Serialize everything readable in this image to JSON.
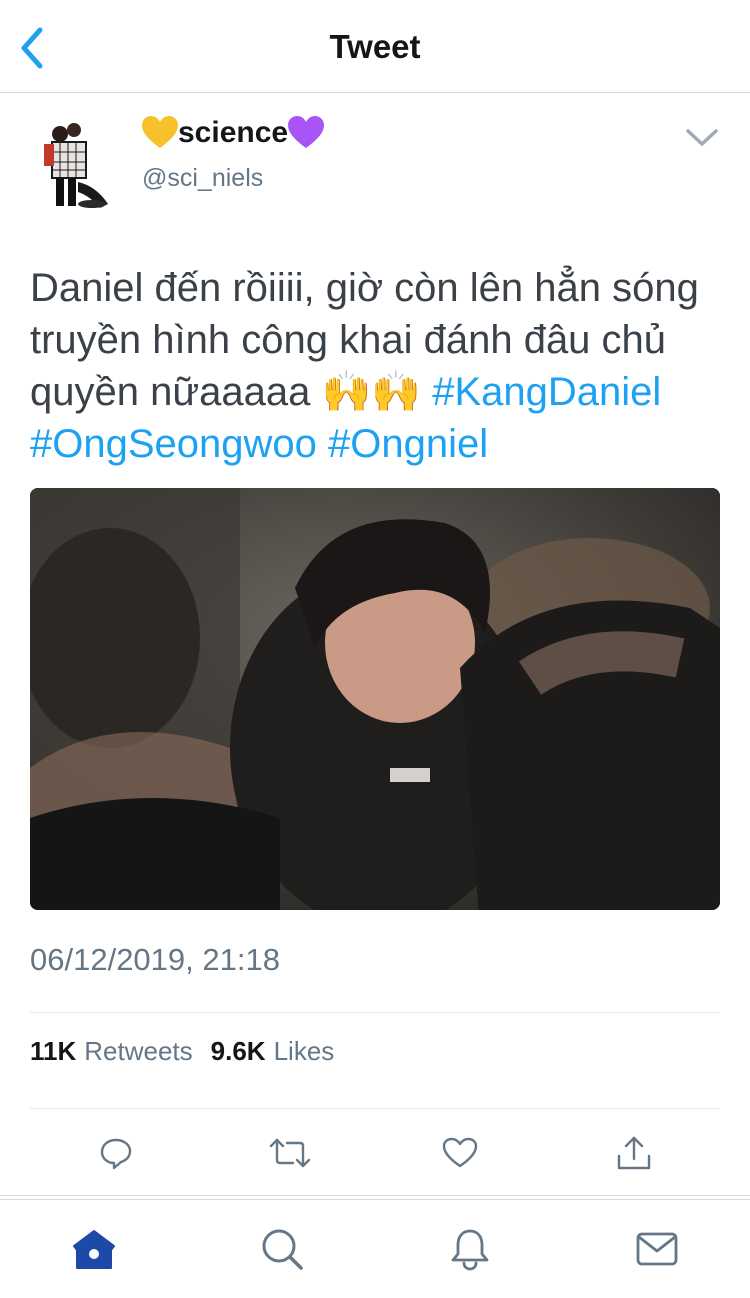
{
  "header": {
    "title": "Tweet",
    "back_icon": "chevron-left-icon"
  },
  "author": {
    "name_prefix_emoji": "yellow-heart",
    "name": "science",
    "name_suffix_emoji": "purple-heart",
    "handle": "@sci_niels",
    "menu_icon": "chevron-down-icon"
  },
  "tweet": {
    "text_line1": "Daniel đến rồiiii, giờ còn lên hẳn sóng",
    "text_line2": "truyền hình công khai đánh đâu chủ",
    "text_line3": "quyền nữaaaaa",
    "emoji": "🙌🙌",
    "hashtags": [
      "#KangDaniel",
      "#OngSeongwoo",
      "#Ongniel"
    ],
    "timestamp": "06/12/2019, 21:18"
  },
  "stats": {
    "retweets_count": "11K",
    "retweets_label": "Retweets",
    "likes_count": "9.6K",
    "likes_label": "Likes"
  },
  "actions": [
    "reply-icon",
    "retweet-icon",
    "like-icon",
    "share-icon"
  ],
  "tabbar": [
    "home-icon",
    "search-icon",
    "notifications-icon",
    "messages-icon"
  ],
  "colors": {
    "accent": "#1da1f2",
    "active_tab": "#1d4aa8",
    "secondary_text": "#657786",
    "body_text": "#3b4148"
  }
}
